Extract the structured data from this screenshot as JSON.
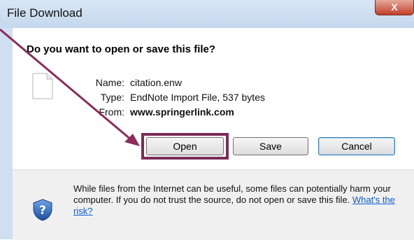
{
  "window": {
    "title": "File Download",
    "close_glyph": "X"
  },
  "dialog": {
    "question": "Do you want to open or save this file?",
    "name_label": "Name:",
    "name_value": "citation.enw",
    "type_label": "Type:",
    "type_value": "EndNote Import File, 537 bytes",
    "from_label": "From:",
    "from_value": "www.springerlink.com",
    "buttons": {
      "open": "Open",
      "save": "Save",
      "cancel": "Cancel"
    },
    "warning_text": "While files from the Internet can be useful, some files can potentially harm your computer. If you do not trust the source, do not open or save this file.",
    "risk_link": "What's the risk?"
  },
  "icons": {
    "file": "file-icon",
    "shield": "shield-question-icon",
    "close": "close-icon"
  },
  "colors": {
    "highlight": "#7b2d58",
    "link": "#0b5ad4",
    "titlebar": "#c5d8ee"
  }
}
